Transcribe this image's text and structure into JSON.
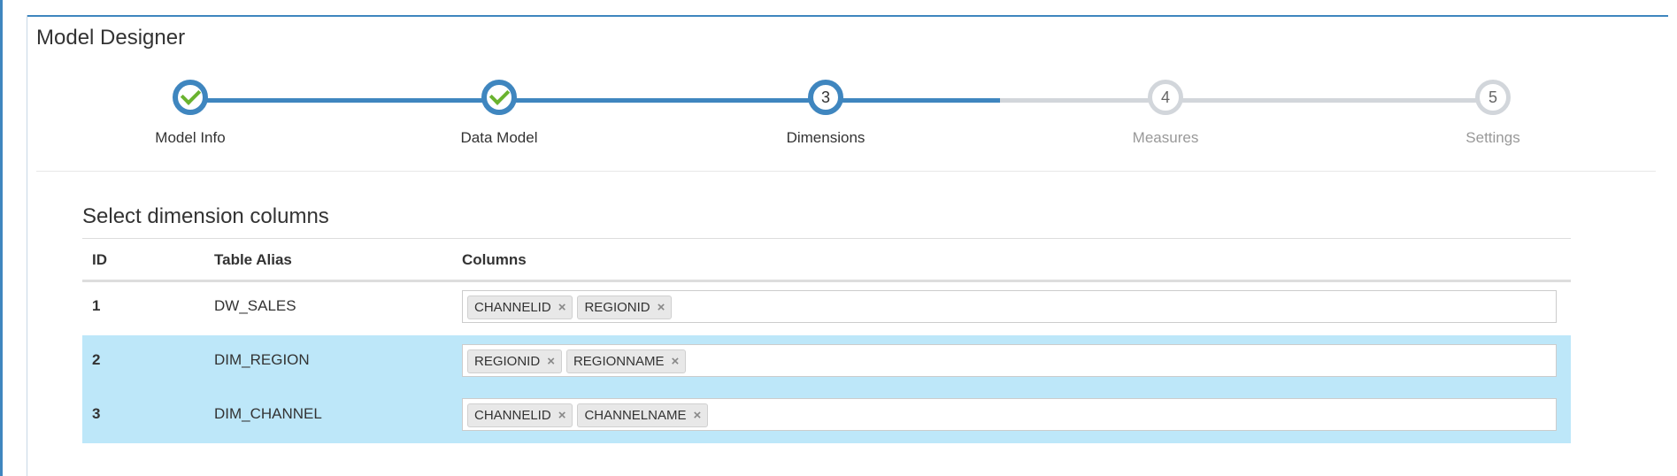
{
  "page_title": "Model Designer",
  "wizard": {
    "steps": [
      {
        "number": "1",
        "label": "Model Info",
        "state": "done"
      },
      {
        "number": "2",
        "label": "Data Model",
        "state": "done"
      },
      {
        "number": "3",
        "label": "Dimensions",
        "state": "active"
      },
      {
        "number": "4",
        "label": "Measures",
        "state": "todo"
      },
      {
        "number": "5",
        "label": "Settings",
        "state": "todo"
      }
    ]
  },
  "section_title": "Select dimension columns",
  "table": {
    "headers": {
      "id": "ID",
      "alias": "Table Alias",
      "columns": "Columns"
    },
    "rows": [
      {
        "id": "1",
        "alias": "DW_SALES",
        "tags": [
          "CHANNELID",
          "REGIONID"
        ],
        "selected": false
      },
      {
        "id": "2",
        "alias": "DIM_REGION",
        "tags": [
          "REGIONID",
          "REGIONNAME"
        ],
        "selected": true
      },
      {
        "id": "3",
        "alias": "DIM_CHANNEL",
        "tags": [
          "CHANNELID",
          "CHANNELNAME"
        ],
        "selected": true
      }
    ]
  },
  "tag_remove_glyph": "×",
  "colors": {
    "accent": "#3f86bf",
    "check": "#6ab32f",
    "selected_row": "#bde7f9",
    "inactive": "#d2d6db"
  }
}
